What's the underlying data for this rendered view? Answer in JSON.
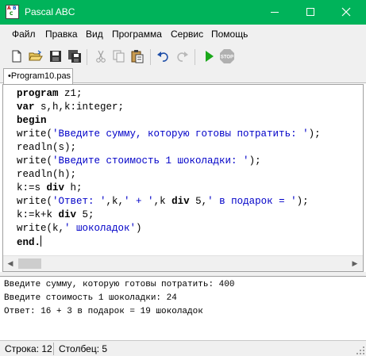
{
  "window": {
    "title": "Pascal ABC",
    "app_icon_letters": [
      "A",
      "B",
      "C"
    ]
  },
  "menu": [
    "Файл",
    "Правка",
    "Вид",
    "Программа",
    "Сервис",
    "Помощь"
  ],
  "toolbar": {
    "icons": [
      "new-file-icon",
      "open-folder-icon",
      "save-icon",
      "save-all-icon",
      "cut-icon",
      "copy-icon",
      "paste-icon",
      "undo-icon",
      "redo-icon",
      "run-icon",
      "stop-icon"
    ],
    "stop_label": "STOP"
  },
  "tab": {
    "label": "•Program10.pas"
  },
  "editor": {
    "lines": [
      {
        "kw1": "program",
        "rest": " z1;"
      },
      {
        "kw1": "var",
        "rest": " s,h,k:integer;"
      },
      {
        "kw1": "begin"
      },
      {
        "pre": "write(",
        "str": "'Введите сумму, которую готовы потратить: '",
        "post": ");"
      },
      {
        "pre": "readln(s);"
      },
      {
        "pre": "write(",
        "str": "'Введите стоимость 1 шоколадки: '",
        "post": ");"
      },
      {
        "pre": "readln(h);"
      },
      {
        "pre": "k:=s ",
        "kw": "div",
        "post": " h;"
      },
      {
        "pre": "write(",
        "str": "'Ответ: '",
        "mid": ",k,",
        "str2": "' + '",
        "mid2": ",k ",
        "kw": "div",
        "mid3": " 5,",
        "str3": "' в подарок = '",
        "post": ");"
      },
      {
        "pre": "k:=k+k ",
        "kw": "div",
        "post": " 5;"
      },
      {
        "pre": "write(k,",
        "str": "' шоколадок'",
        "post": ")"
      },
      {
        "kw1": "end",
        "rest": "."
      }
    ]
  },
  "output": {
    "lines": [
      "Введите сумму, которую готовы потратить: 400",
      "Введите стоимость 1 шоколадки: 24",
      "Ответ: 16 + 3 в подарок = 19 шоколадок"
    ]
  },
  "status": {
    "line": "Строка: 12",
    "column": "Столбец: 5"
  },
  "colors": {
    "titlebar": "#00b35a",
    "keyword": "#000000",
    "string": "#0000c8",
    "run": "#1aa81a",
    "stop": "#b0b0b0"
  }
}
